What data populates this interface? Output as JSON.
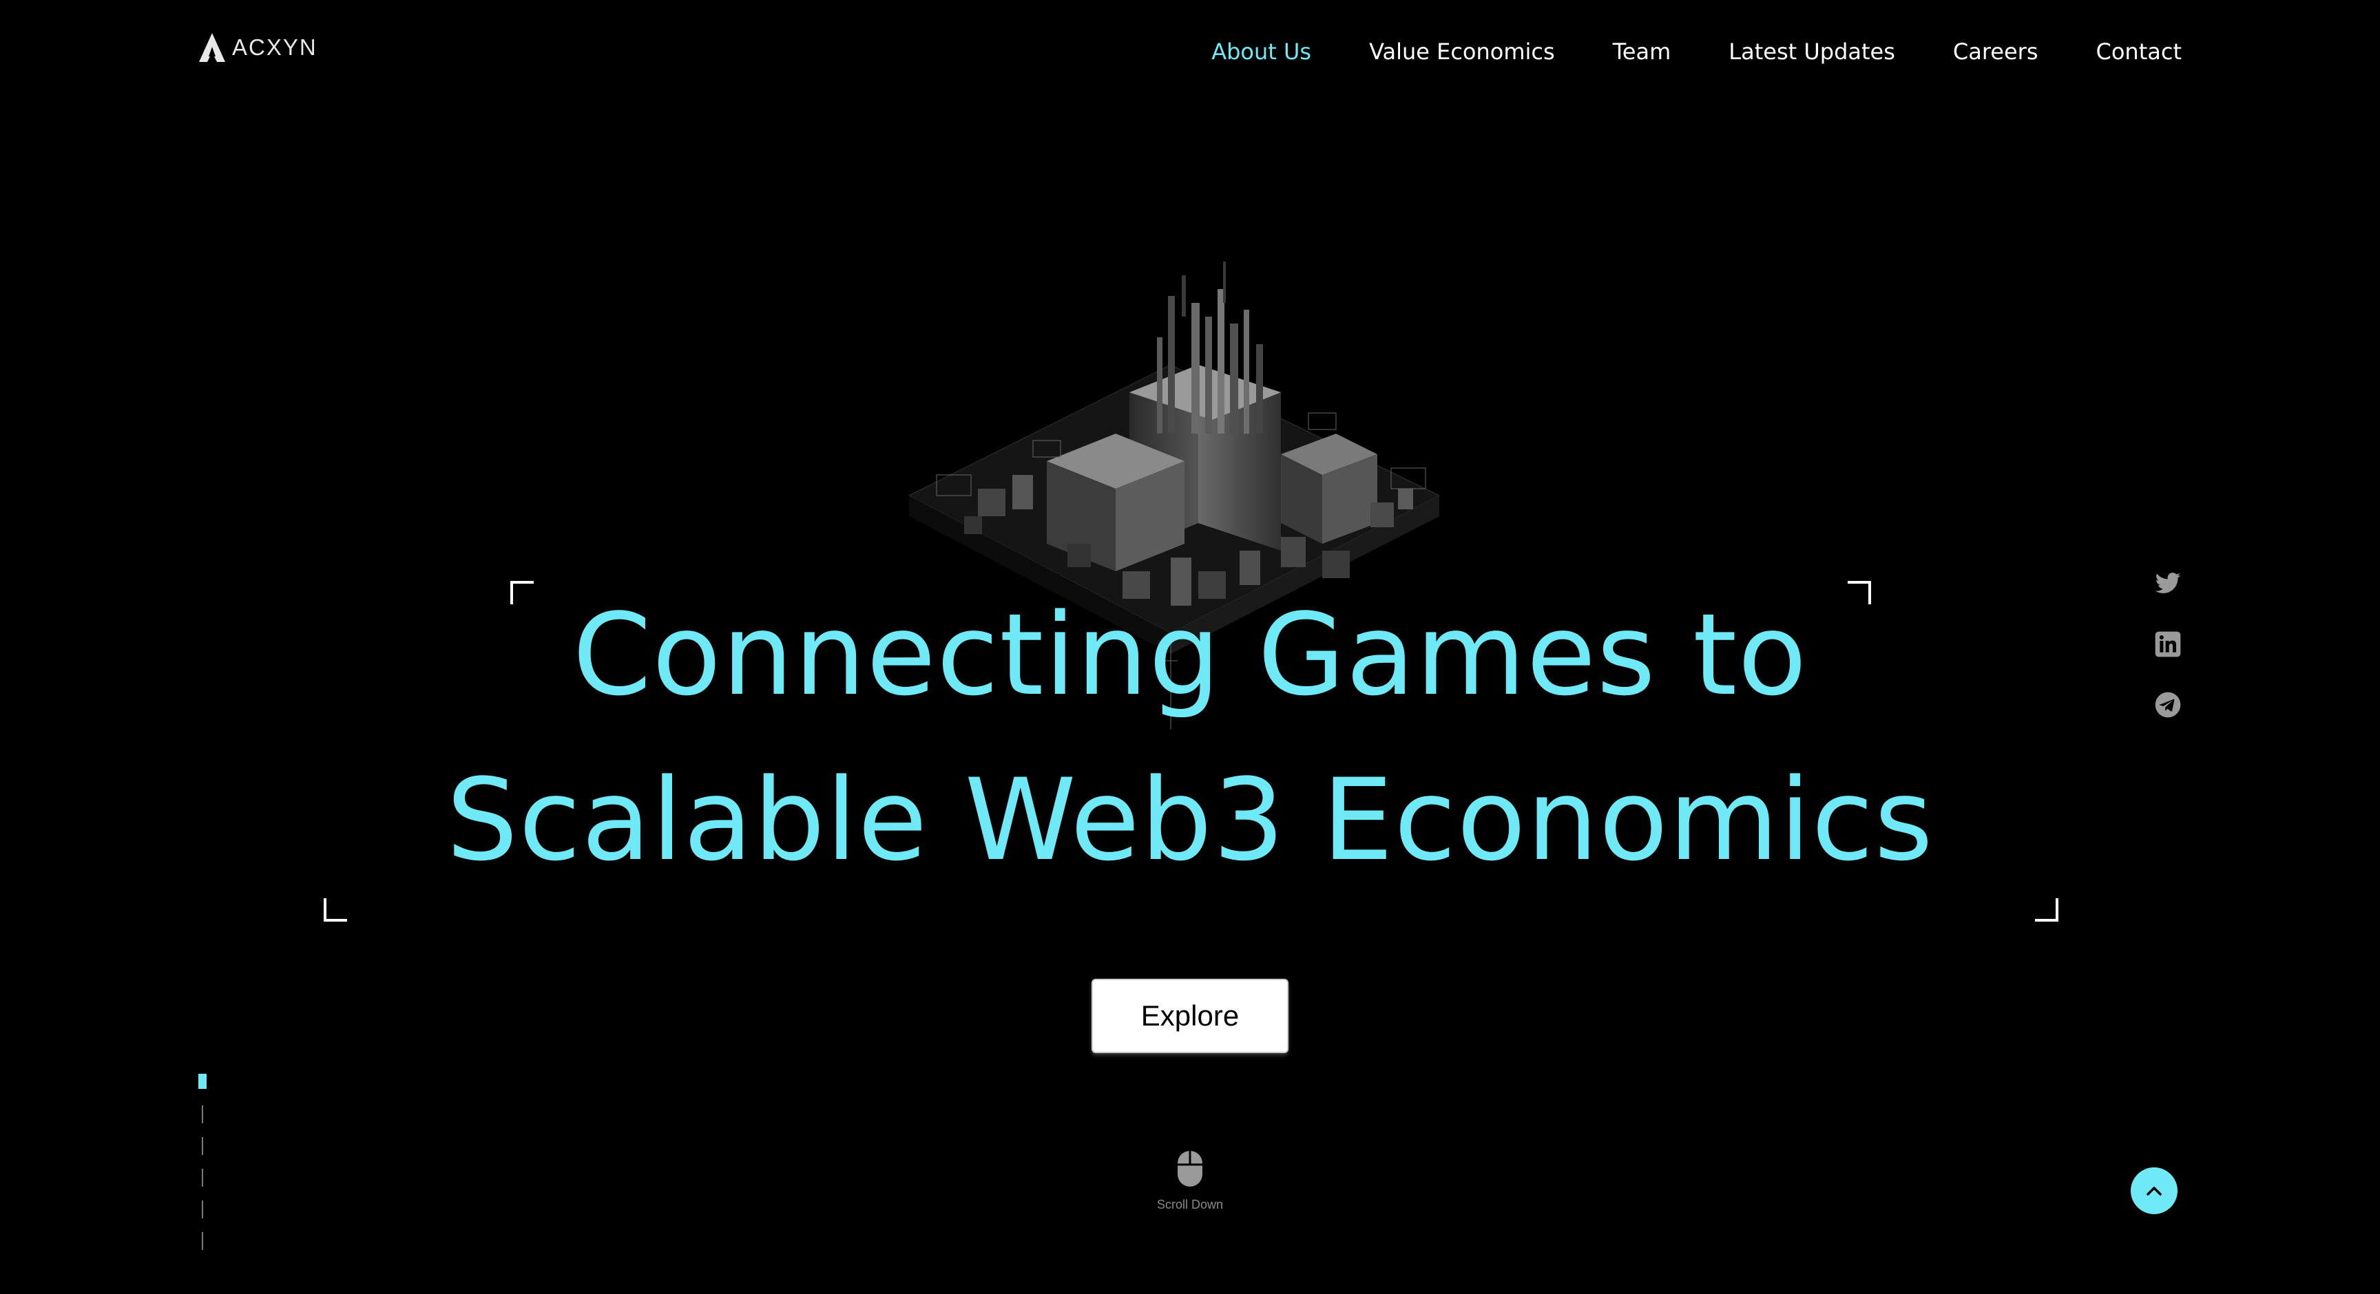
{
  "brand": {
    "name": "ACXYN"
  },
  "nav": {
    "items": [
      {
        "label": "About Us",
        "active": true
      },
      {
        "label": "Value Economics",
        "active": false
      },
      {
        "label": "Team",
        "active": false
      },
      {
        "label": "Latest Updates",
        "active": false
      },
      {
        "label": "Careers",
        "active": false
      },
      {
        "label": "Contact",
        "active": false
      }
    ]
  },
  "hero": {
    "headline_line1": "Connecting Games to",
    "headline_line2": "Scalable Web3 Economics",
    "cta_label": "Explore",
    "image": "isometric-city-icon"
  },
  "social": {
    "icons": [
      "twitter-icon",
      "linkedin-icon",
      "telegram-icon"
    ]
  },
  "scroll": {
    "label": "Scroll Down",
    "icon": "mouse-icon",
    "top_icon": "chevron-up-icon",
    "section_count": 6,
    "active_section": 1
  },
  "colors": {
    "accent": "#6ee9f5",
    "background": "#000000",
    "text": "#ffffff"
  }
}
